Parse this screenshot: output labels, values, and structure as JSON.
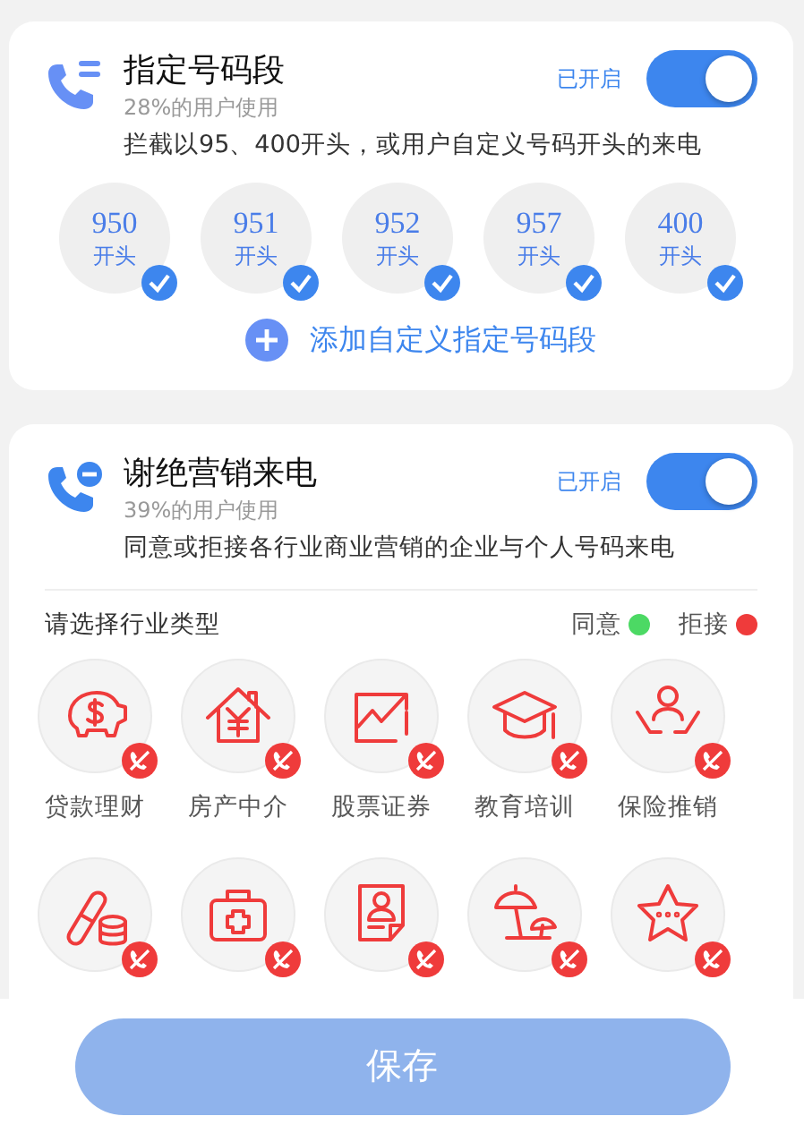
{
  "number_range": {
    "title": "指定号码段",
    "usage": "28%的用户使用",
    "status": "已开启",
    "on": true,
    "description": "拦截以95、400开头，或用户自定义号码开头的来电",
    "prefixes": [
      {
        "number": "950",
        "suffix": "开头",
        "checked": true
      },
      {
        "number": "951",
        "suffix": "开头",
        "checked": true
      },
      {
        "number": "952",
        "suffix": "开头",
        "checked": true
      },
      {
        "number": "957",
        "suffix": "开头",
        "checked": true
      },
      {
        "number": "400",
        "suffix": "开头",
        "checked": true
      }
    ],
    "add_label": "添加自定义指定号码段"
  },
  "marketing_calls": {
    "title": "谢绝营销来电",
    "usage": "39%的用户使用",
    "status": "已开启",
    "on": true,
    "description": "同意或拒接各行业商业营销的企业与个人号码来电",
    "prompt": "请选择行业类型",
    "legend": [
      {
        "label": "同意",
        "color": "#4cd964"
      },
      {
        "label": "拒接",
        "color": "#ef3b3b"
      }
    ],
    "industries": [
      {
        "label": "贷款理财",
        "rejected": true
      },
      {
        "label": "房产中介",
        "rejected": true
      },
      {
        "label": "股票证券",
        "rejected": true
      },
      {
        "label": "教育培训",
        "rejected": true
      },
      {
        "label": "保险推销",
        "rejected": true
      },
      {
        "rejected": true
      },
      {
        "rejected": true
      },
      {
        "rejected": true
      },
      {
        "rejected": true
      },
      {
        "rejected": true
      }
    ]
  },
  "save_button": {
    "label": "保存",
    "disabled": true
  }
}
